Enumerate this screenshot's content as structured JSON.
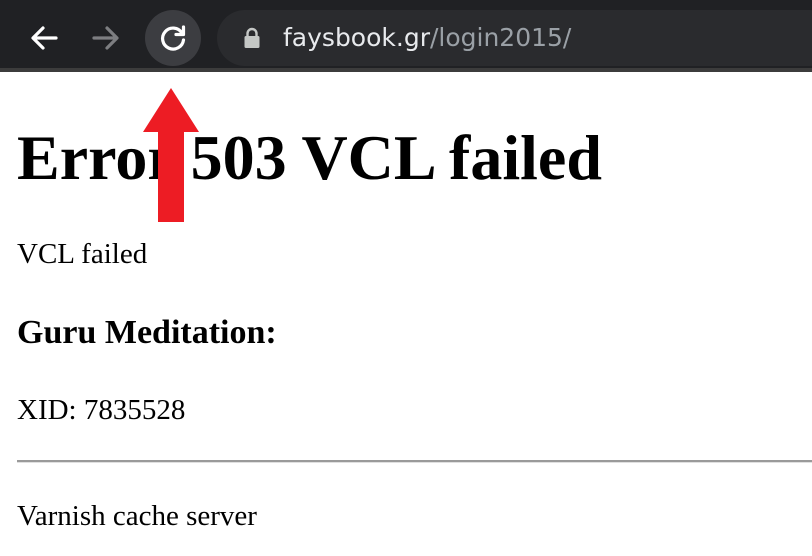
{
  "browser": {
    "url_host": "faysbook.gr",
    "url_path": "/login2015/",
    "icons": {
      "back": "back-arrow-icon",
      "forward": "forward-arrow-icon",
      "reload": "reload-icon",
      "lock": "lock-icon"
    },
    "colors": {
      "toolbar_bg": "#202124",
      "omnibox_bg": "#2a2b2e",
      "host_text": "#e8eaed",
      "path_text": "#9aa0a6"
    }
  },
  "page": {
    "heading": "Error 503 VCL failed",
    "message": "VCL failed",
    "guru_title": "Guru Meditation:",
    "xid": "XID: 7835528",
    "footer": "Varnish cache server"
  },
  "annotation": {
    "arrow_icon": "red-up-arrow-icon",
    "arrow_color": "#ed1c24"
  }
}
